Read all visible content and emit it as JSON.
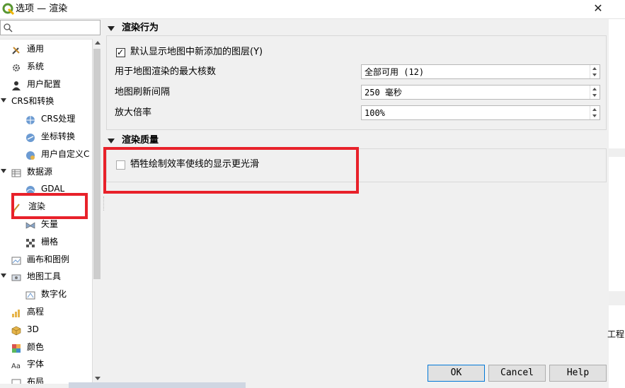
{
  "window": {
    "title": "选项 — 渲染",
    "close_glyph": "✕"
  },
  "search": {
    "placeholder": ""
  },
  "sidebar": {
    "items": [
      {
        "label": "通用",
        "icon": "tools-icon",
        "indent": 0,
        "expandable": false
      },
      {
        "label": "系统",
        "icon": "gear-icon",
        "indent": 0,
        "expandable": false
      },
      {
        "label": "用户配置",
        "icon": "user-icon",
        "indent": 0,
        "expandable": false
      },
      {
        "label": "CRS和转换",
        "icon": "",
        "indent": 0,
        "expandable": true
      },
      {
        "label": "CRS处理",
        "icon": "globe-icon",
        "indent": 1,
        "expandable": false
      },
      {
        "label": "坐标转换",
        "icon": "globe-transform-icon",
        "indent": 1,
        "expandable": false
      },
      {
        "label": "用户自定义C",
        "icon": "globe-user-icon",
        "indent": 1,
        "expandable": false
      },
      {
        "label": "数据源",
        "icon": "table-icon",
        "indent": 0,
        "expandable": true
      },
      {
        "label": "GDAL",
        "icon": "gdal-icon",
        "indent": 1,
        "expandable": false
      },
      {
        "label": "渲染",
        "icon": "paintbrush-icon",
        "indent": 0,
        "expandable": false,
        "selected": true
      },
      {
        "label": "矢量",
        "icon": "vector-icon",
        "indent": 1,
        "expandable": false
      },
      {
        "label": "栅格",
        "icon": "raster-icon",
        "indent": 1,
        "expandable": false
      },
      {
        "label": "画布和图例",
        "icon": "canvas-icon",
        "indent": 0,
        "expandable": false
      },
      {
        "label": "地图工具",
        "icon": "map-tools-icon",
        "indent": 0,
        "expandable": true
      },
      {
        "label": "数字化",
        "icon": "digitize-icon",
        "indent": 1,
        "expandable": false
      },
      {
        "label": "高程",
        "icon": "elevation-icon",
        "indent": 0,
        "expandable": false
      },
      {
        "label": "3D",
        "icon": "cube-icon",
        "indent": 0,
        "expandable": false
      },
      {
        "label": "颜色",
        "icon": "palette-icon",
        "indent": 0,
        "expandable": false
      },
      {
        "label": "字体",
        "icon": "font-icon",
        "indent": 0,
        "expandable": false
      },
      {
        "label": "布局",
        "icon": "layout-icon",
        "indent": 0,
        "expandable": false
      }
    ]
  },
  "rendering_behavior": {
    "title": "渲染行为",
    "default_show_new_layers": {
      "label": "默认显示地图中新添加的图层(Y)",
      "checked": true
    },
    "max_cores": {
      "label": "用于地图渲染的最大核数",
      "value": "全部可用 (12)"
    },
    "refresh_interval": {
      "label": "地图刷新间隔",
      "value": "250 毫秒"
    },
    "magnification": {
      "label": "放大倍率",
      "value": "100%"
    }
  },
  "rendering_quality": {
    "title": "渲染质量",
    "smooth_lines": {
      "label": "牺牲绘制效率使线的显示更光滑",
      "checked": false
    }
  },
  "background": {
    "peek_text": "工程b"
  },
  "buttons": {
    "ok": "OK",
    "cancel": "Cancel",
    "help": "Help"
  },
  "colors": {
    "highlight_red": "#e8212a",
    "ok_border": "#0078d7"
  }
}
